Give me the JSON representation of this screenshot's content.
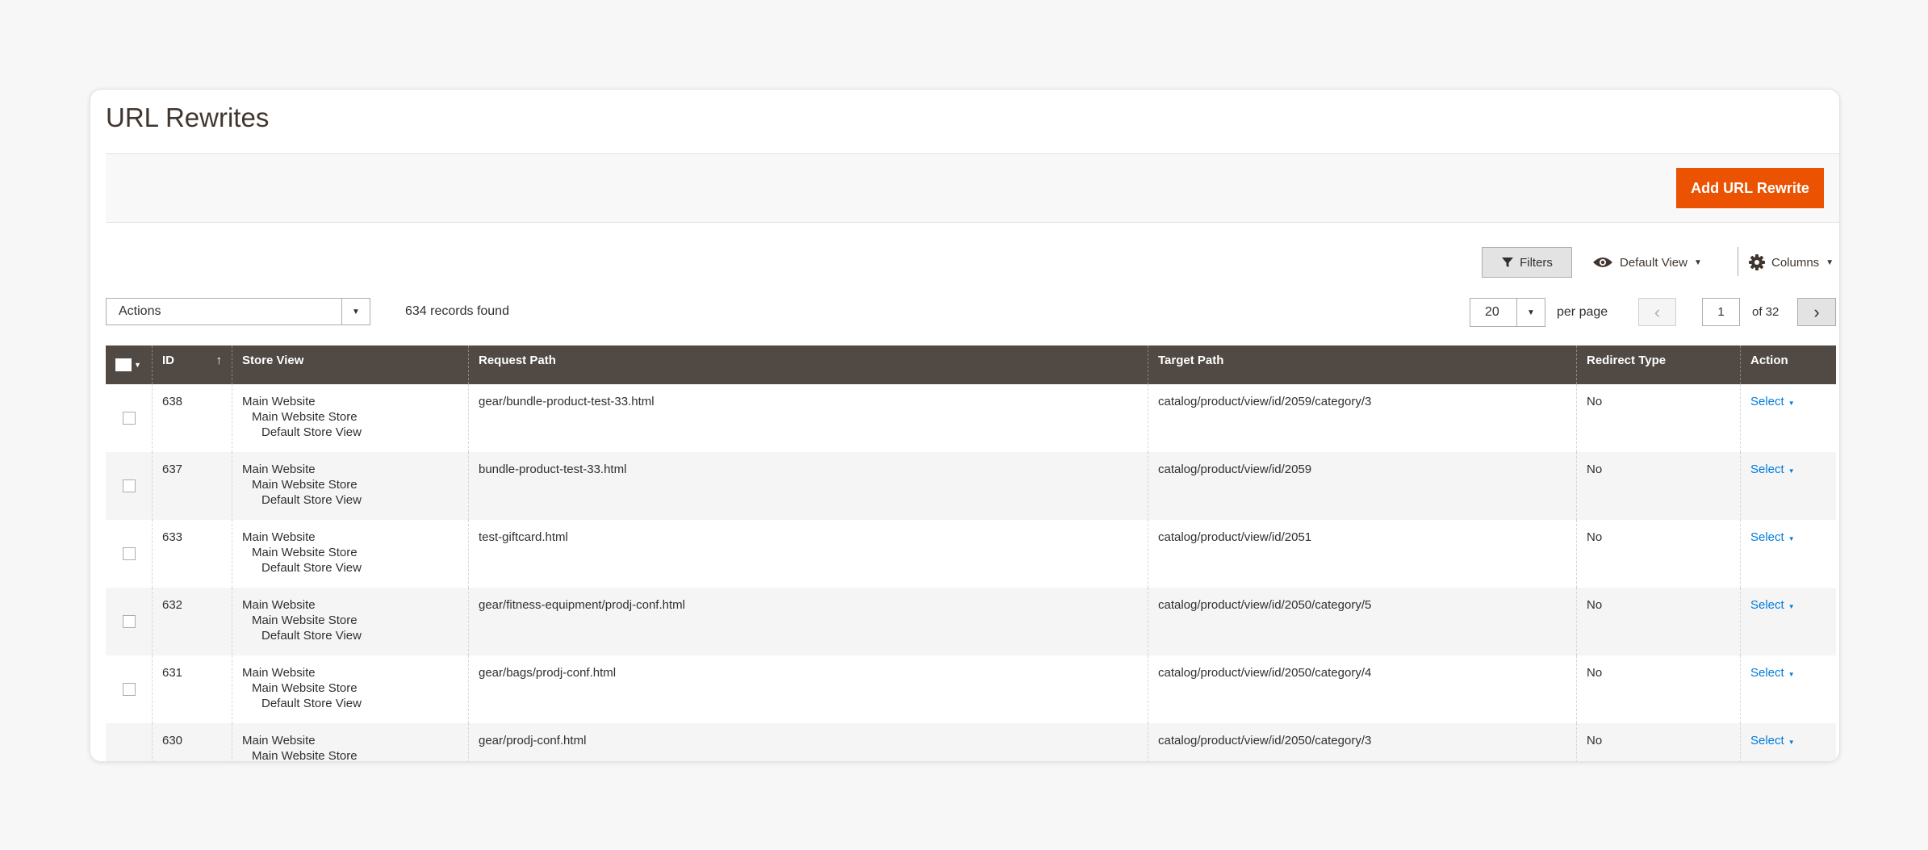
{
  "page": {
    "title": "URL Rewrites"
  },
  "header_actions": {
    "add_label": "Add URL Rewrite"
  },
  "toolbar": {
    "filters_label": "Filters",
    "view_label": "Default View",
    "columns_label": "Columns"
  },
  "mass_actions": {
    "label": "Actions"
  },
  "records_found": "634 records found",
  "pagination": {
    "per_page_value": "20",
    "per_page_label": "per page",
    "current_page": "1",
    "of_label": "of 32"
  },
  "columns": [
    {
      "key": "id",
      "label": "ID"
    },
    {
      "key": "store_view",
      "label": "Store View"
    },
    {
      "key": "request_path",
      "label": "Request Path"
    },
    {
      "key": "target_path",
      "label": "Target Path"
    },
    {
      "key": "redirect_type",
      "label": "Redirect Type"
    },
    {
      "key": "action",
      "label": "Action"
    }
  ],
  "sort_indicator": "↑",
  "rows": [
    {
      "id": "638",
      "store_website": "Main Website",
      "store_store": "Main Website Store",
      "store_view": "Default Store View",
      "request_path": "gear/bundle-product-test-33.html",
      "target_path": "catalog/product/view/id/2059/category/3",
      "redirect_type": "No",
      "action": "Select"
    },
    {
      "id": "637",
      "store_website": "Main Website",
      "store_store": "Main Website Store",
      "store_view": "Default Store View",
      "request_path": "bundle-product-test-33.html",
      "target_path": "catalog/product/view/id/2059",
      "redirect_type": "No",
      "action": "Select"
    },
    {
      "id": "633",
      "store_website": "Main Website",
      "store_store": "Main Website Store",
      "store_view": "Default Store View",
      "request_path": "test-giftcard.html",
      "target_path": "catalog/product/view/id/2051",
      "redirect_type": "No",
      "action": "Select"
    },
    {
      "id": "632",
      "store_website": "Main Website",
      "store_store": "Main Website Store",
      "store_view": "Default Store View",
      "request_path": "gear/fitness-equipment/prodj-conf.html",
      "target_path": "catalog/product/view/id/2050/category/5",
      "redirect_type": "No",
      "action": "Select"
    },
    {
      "id": "631",
      "store_website": "Main Website",
      "store_store": "Main Website Store",
      "store_view": "Default Store View",
      "request_path": "gear/bags/prodj-conf.html",
      "target_path": "catalog/product/view/id/2050/category/4",
      "redirect_type": "No",
      "action": "Select"
    },
    {
      "id": "630",
      "store_website": "Main Website",
      "store_store": "Main Website Store",
      "store_view": "",
      "request_path": "gear/prodj-conf.html",
      "target_path": "catalog/product/view/id/2050/category/3",
      "redirect_type": "No",
      "action": "Select"
    }
  ],
  "colors": {
    "accent": "#eb5202",
    "header_bg": "#514943",
    "link": "#007bdb"
  }
}
